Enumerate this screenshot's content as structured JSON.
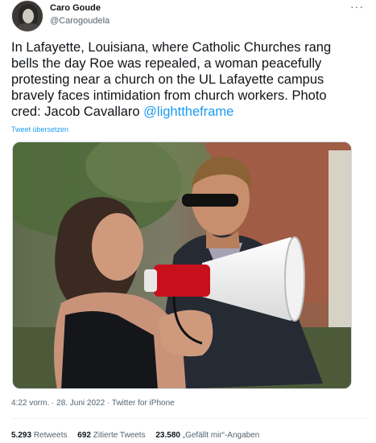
{
  "tweet": {
    "author": {
      "display_name": "Caro Goude",
      "handle": "@Carogoudela"
    },
    "more_icon": "ellipsis-icon",
    "text_main": "In Lafayette, Louisiana, where Catholic Churches rang bells the day Roe was repealed, a woman peacefully protesting near a church on the UL Lafayette campus bravely faces intimidation from church workers.  Photo cred: Jacob Cavallaro ",
    "text_mention": "@lighttheframe",
    "translate_label": "Tweet übersetzen",
    "timestamp": "4:22 vorm. · 28. Juni 2022 · Twitter for iPhone",
    "stats": {
      "retweets_count": "5.293",
      "retweets_label": "Retweets",
      "quotes_count": "692",
      "quotes_label": "Zitierte Tweets",
      "likes_count": "23.580",
      "likes_label": "„Gefällt mir“-Angaben"
    }
  }
}
